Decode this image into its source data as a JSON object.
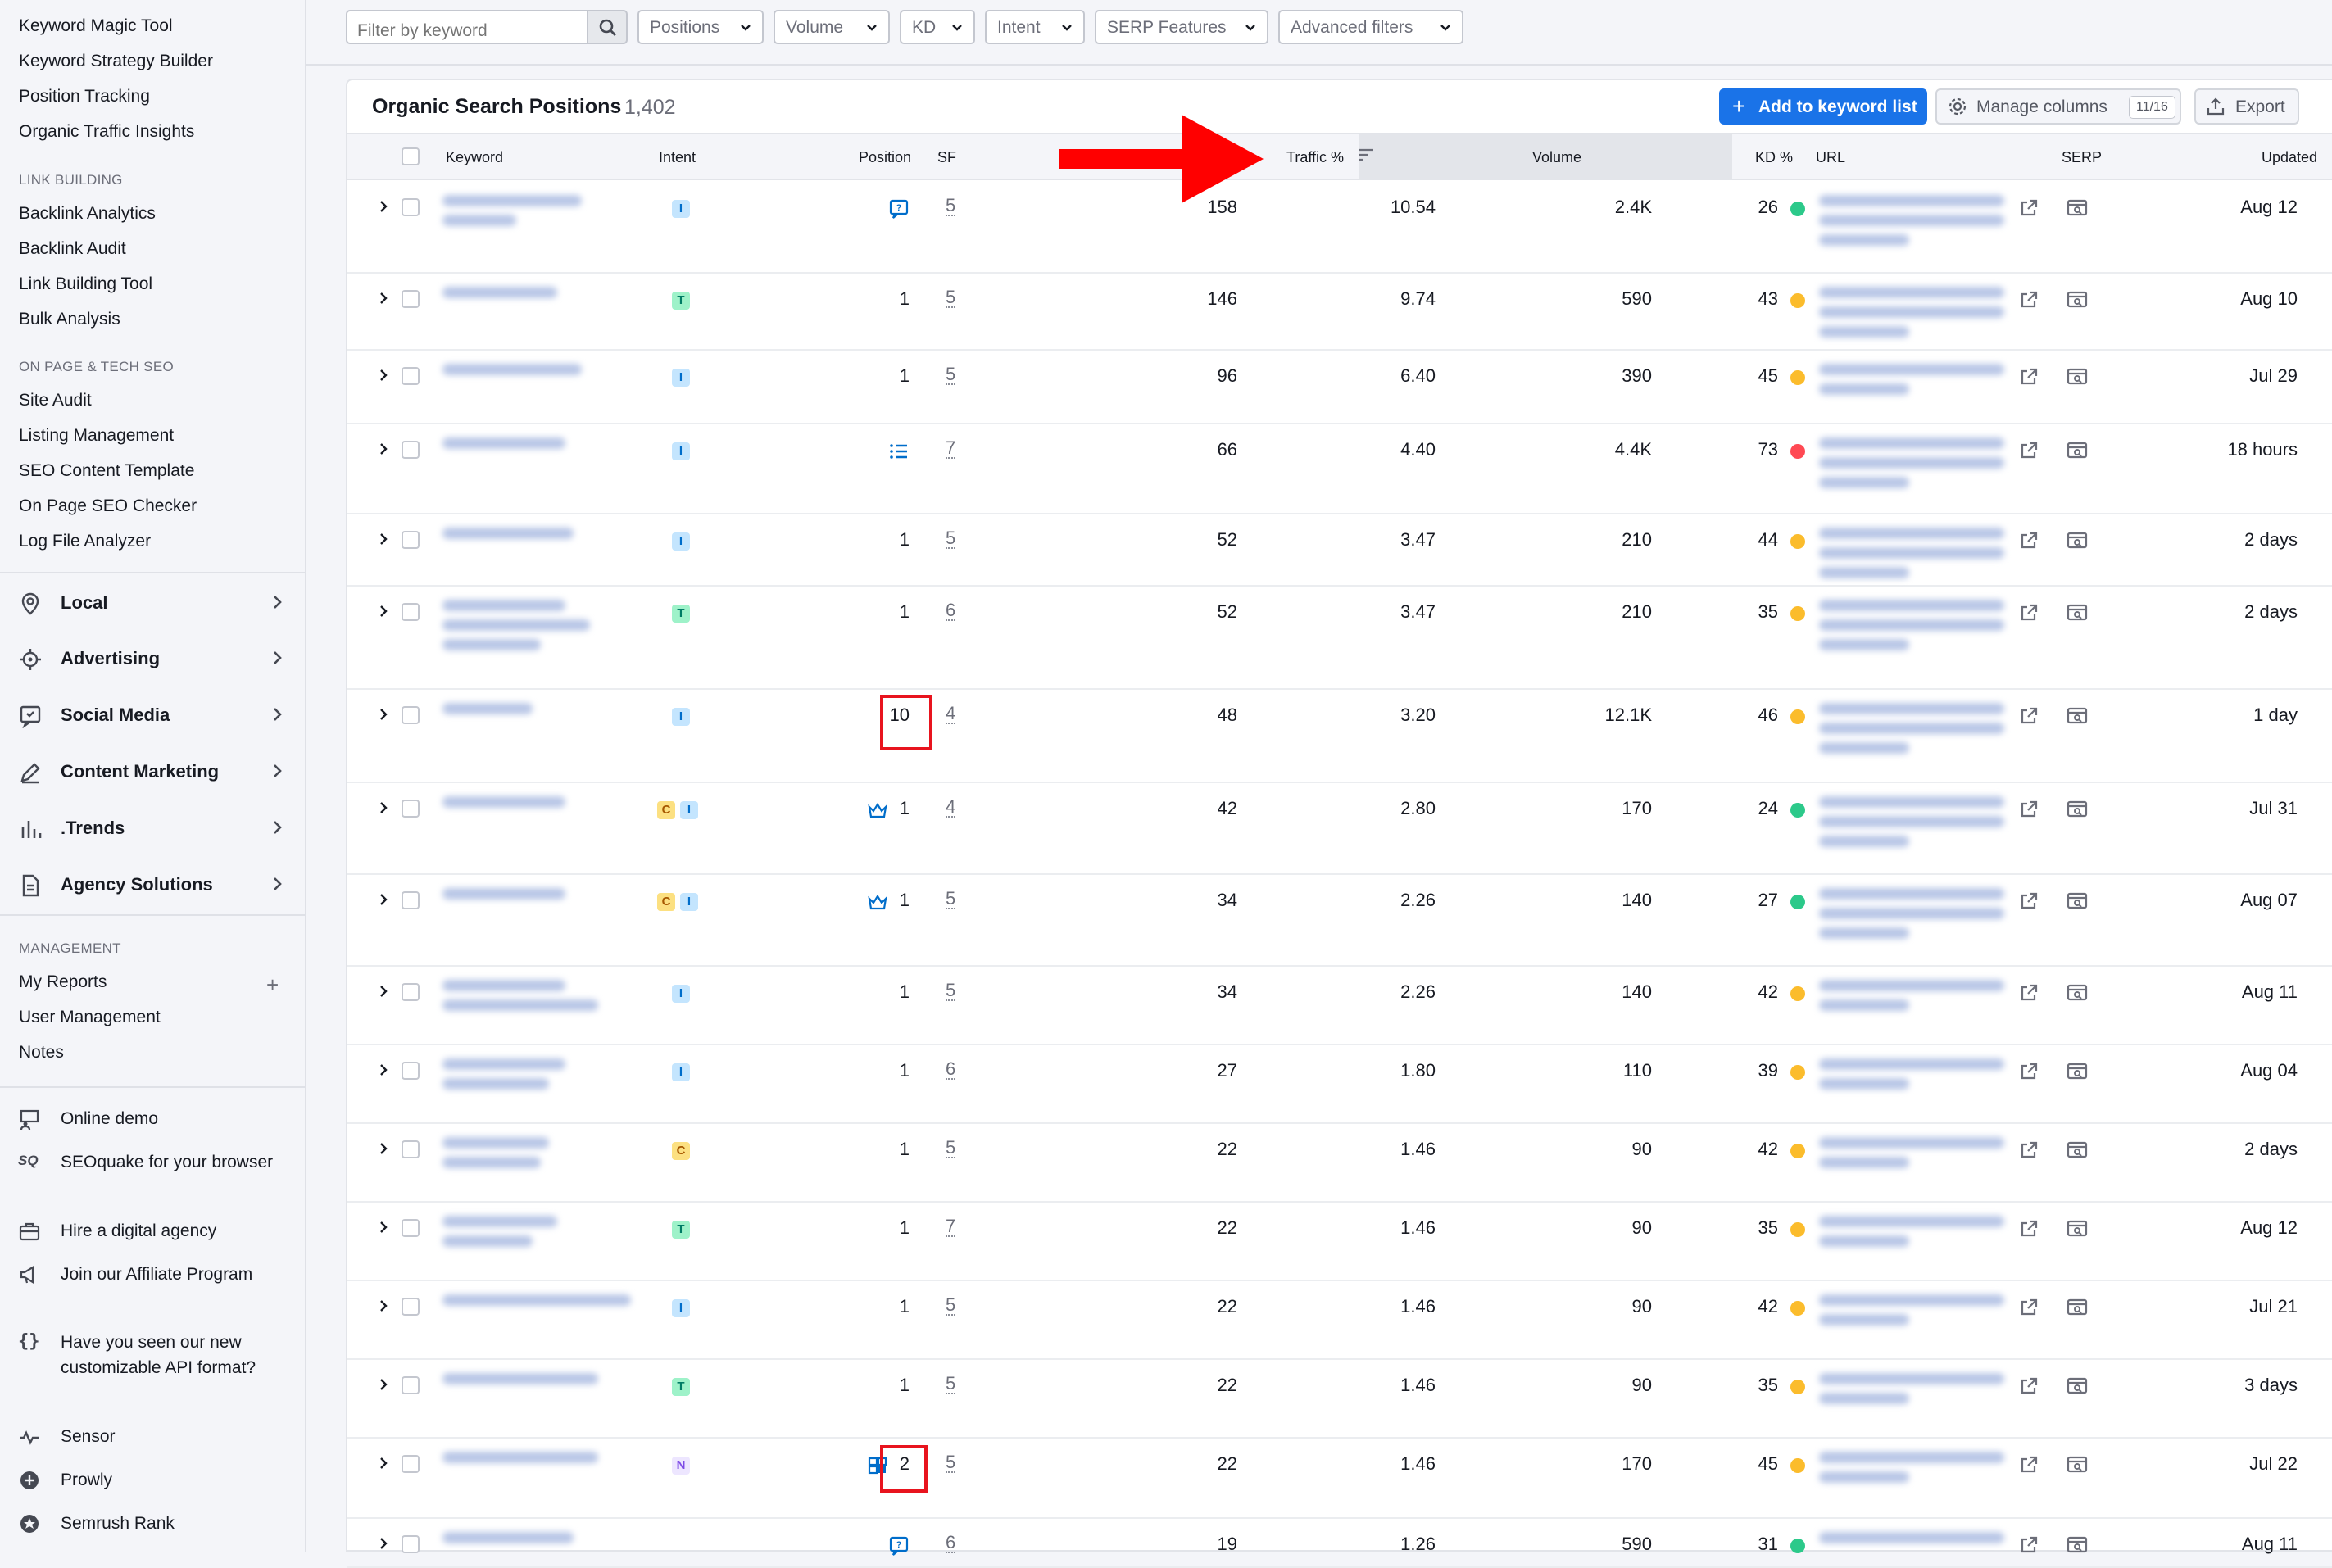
{
  "sidebar": {
    "top_links": [
      "Keyword Magic Tool",
      "Keyword Strategy Builder",
      "Position Tracking",
      "Organic Traffic Insights"
    ],
    "link_building_heading": "LINK BUILDING",
    "link_building": [
      "Backlink Analytics",
      "Backlink Audit",
      "Link Building Tool",
      "Bulk Analysis"
    ],
    "onpage_heading": "ON PAGE & TECH SEO",
    "onpage": [
      "Site Audit",
      "Listing Management",
      "SEO Content Template",
      "On Page SEO Checker",
      "Log File Analyzer"
    ],
    "categories": [
      {
        "label": "Local",
        "icon": "location-pin-icon"
      },
      {
        "label": "Advertising",
        "icon": "target-icon"
      },
      {
        "label": "Social Media",
        "icon": "social-icon"
      },
      {
        "label": "Content Marketing",
        "icon": "pencil-icon"
      },
      {
        "label": ".Trends",
        "icon": "bars-icon"
      },
      {
        "label": "Agency Solutions",
        "icon": "document-icon"
      }
    ],
    "management_heading": "MANAGEMENT",
    "management": [
      "My Reports",
      "User Management",
      "Notes"
    ],
    "footer": [
      {
        "label": "Online demo",
        "icon": "presenter-icon"
      },
      {
        "label": "SEOquake for your browser",
        "icon": "seoquake-icon"
      },
      {
        "label": "Hire a digital agency",
        "icon": "agency-icon"
      },
      {
        "label": "Join our Affiliate Program",
        "icon": "megaphone-icon"
      },
      {
        "label": "Have you seen our new customizable API format?",
        "icon": "braces-icon"
      },
      {
        "label": "Sensor",
        "icon": "pulse-icon"
      },
      {
        "label": "Prowly",
        "icon": "prowly-icon"
      },
      {
        "label": "Semrush Rank",
        "icon": "star-badge-icon"
      }
    ]
  },
  "filters": {
    "search_placeholder": "Filter by keyword",
    "dropdowns": [
      "Positions",
      "Volume",
      "KD",
      "Intent",
      "SERP Features",
      "Advanced filters"
    ]
  },
  "card": {
    "title": "Organic Search Positions",
    "count": "1,402",
    "add_button": "Add to keyword list",
    "manage_button": "Manage columns",
    "manage_badge": "11/16",
    "export_button": "Export"
  },
  "table": {
    "headers": {
      "keyword": "Keyword",
      "intent": "Intent",
      "position": "Position",
      "sf": "SF",
      "traffic_pct": "Traffic %",
      "volume": "Volume",
      "kd": "KD %",
      "url": "URL",
      "serp": "SERP",
      "updated": "Updated"
    },
    "rows": [
      {
        "intent": [
          "I"
        ],
        "position": "",
        "pos_icon": "faq-icon",
        "sf": "5",
        "traffic": "158",
        "traffic_pct": "10.54",
        "volume": "2.4K",
        "kd": "26",
        "kd_color": "#2cc98a",
        "updated": "Aug 12"
      },
      {
        "intent": [
          "T"
        ],
        "position": "1",
        "pos_icon": "",
        "sf": "5",
        "traffic": "146",
        "traffic_pct": "9.74",
        "volume": "590",
        "kd": "43",
        "kd_color": "#fbbc2c",
        "updated": "Aug 10"
      },
      {
        "intent": [
          "I"
        ],
        "position": "1",
        "pos_icon": "",
        "sf": "5",
        "traffic": "96",
        "traffic_pct": "6.40",
        "volume": "390",
        "kd": "45",
        "kd_color": "#fbbc2c",
        "updated": "Jul 29"
      },
      {
        "intent": [
          "I"
        ],
        "position": "",
        "pos_icon": "list-icon",
        "sf": "7",
        "traffic": "66",
        "traffic_pct": "4.40",
        "volume": "4.4K",
        "kd": "73",
        "kd_color": "#ff4953",
        "updated": "18 hours"
      },
      {
        "intent": [
          "I"
        ],
        "position": "1",
        "pos_icon": "",
        "sf": "5",
        "traffic": "52",
        "traffic_pct": "3.47",
        "volume": "210",
        "kd": "44",
        "kd_color": "#fbbc2c",
        "updated": "2 days"
      },
      {
        "intent": [
          "T"
        ],
        "position": "1",
        "pos_icon": "",
        "sf": "6",
        "traffic": "52",
        "traffic_pct": "3.47",
        "volume": "210",
        "kd": "35",
        "kd_color": "#fbbc2c",
        "updated": "2 days"
      },
      {
        "intent": [
          "I"
        ],
        "position": "10",
        "pos_icon": "",
        "sf": "4",
        "traffic": "48",
        "traffic_pct": "3.20",
        "volume": "12.1K",
        "kd": "46",
        "kd_color": "#fbbc2c",
        "updated": "1 day"
      },
      {
        "intent": [
          "C",
          "I"
        ],
        "position": "1",
        "pos_icon": "crown-icon",
        "sf": "4",
        "traffic": "42",
        "traffic_pct": "2.80",
        "volume": "170",
        "kd": "24",
        "kd_color": "#2cc98a",
        "updated": "Jul 31"
      },
      {
        "intent": [
          "C",
          "I"
        ],
        "position": "1",
        "pos_icon": "crown-icon",
        "sf": "5",
        "traffic": "34",
        "traffic_pct": "2.26",
        "volume": "140",
        "kd": "27",
        "kd_color": "#2cc98a",
        "updated": "Aug 07"
      },
      {
        "intent": [
          "I"
        ],
        "position": "1",
        "pos_icon": "",
        "sf": "5",
        "traffic": "34",
        "traffic_pct": "2.26",
        "volume": "140",
        "kd": "42",
        "kd_color": "#fbbc2c",
        "updated": "Aug 11"
      },
      {
        "intent": [
          "I"
        ],
        "position": "1",
        "pos_icon": "",
        "sf": "6",
        "traffic": "27",
        "traffic_pct": "1.80",
        "volume": "110",
        "kd": "39",
        "kd_color": "#fbbc2c",
        "updated": "Aug 04"
      },
      {
        "intent": [
          "C"
        ],
        "position": "1",
        "pos_icon": "",
        "sf": "5",
        "traffic": "22",
        "traffic_pct": "1.46",
        "volume": "90",
        "kd": "42",
        "kd_color": "#fbbc2c",
        "updated": "2 days"
      },
      {
        "intent": [
          "T"
        ],
        "position": "1",
        "pos_icon": "",
        "sf": "7",
        "traffic": "22",
        "traffic_pct": "1.46",
        "volume": "90",
        "kd": "35",
        "kd_color": "#fbbc2c",
        "updated": "Aug 12"
      },
      {
        "intent": [
          "I"
        ],
        "position": "1",
        "pos_icon": "",
        "sf": "5",
        "traffic": "22",
        "traffic_pct": "1.46",
        "volume": "90",
        "kd": "42",
        "kd_color": "#fbbc2c",
        "updated": "Jul 21"
      },
      {
        "intent": [
          "T"
        ],
        "position": "1",
        "pos_icon": "",
        "sf": "5",
        "traffic": "22",
        "traffic_pct": "1.46",
        "volume": "90",
        "kd": "35",
        "kd_color": "#fbbc2c",
        "updated": "3 days"
      },
      {
        "intent": [
          "N"
        ],
        "position": "2",
        "pos_icon": "image-pack-icon",
        "sf": "5",
        "traffic": "22",
        "traffic_pct": "1.46",
        "volume": "170",
        "kd": "45",
        "kd_color": "#fbbc2c",
        "updated": "Jul 22"
      },
      {
        "intent": [],
        "position": "",
        "pos_icon": "faq-icon",
        "sf": "6",
        "traffic": "19",
        "traffic_pct": "1.26",
        "volume": "590",
        "kd": "31",
        "kd_color": "#2cc98a",
        "updated": "Aug 11"
      }
    ]
  },
  "colors": {
    "accent": "#1a73e8",
    "annotation_red": "#e8141e"
  }
}
